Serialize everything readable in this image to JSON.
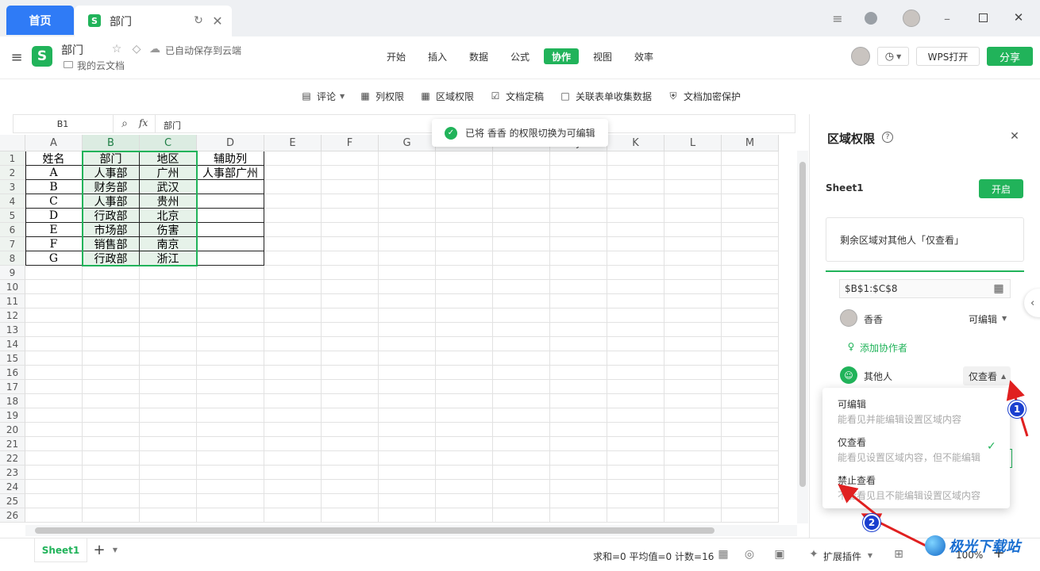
{
  "tabs": {
    "home": "首页",
    "doc": "部门"
  },
  "app": {
    "doc_title": "部门",
    "autosave": "已自动保存到云端",
    "location": "我的云文档"
  },
  "menu": [
    "开始",
    "插入",
    "数据",
    "公式",
    "协作",
    "视图",
    "效率"
  ],
  "actions": {
    "wps_open": "WPS打开",
    "share": "分享"
  },
  "toolbar": [
    "评论",
    "列权限",
    "区域权限",
    "文档定稿",
    "关联表单收集数据",
    "文档加密保护"
  ],
  "formula": {
    "cell_ref": "B1",
    "fx": "fx",
    "value": "部门"
  },
  "toast": "已将 香香 的权限切换为可编辑",
  "grid": {
    "columns": [
      "A",
      "B",
      "C",
      "D",
      "E",
      "F",
      "G",
      "H",
      "I",
      "J",
      "K",
      "L",
      "M"
    ],
    "rows": [
      "1",
      "2",
      "3",
      "4",
      "5",
      "6",
      "7",
      "8",
      "9",
      "10",
      "11",
      "12",
      "13",
      "14",
      "15",
      "16",
      "17",
      "18",
      "19",
      "20",
      "21",
      "22",
      "23",
      "24",
      "25",
      "26"
    ],
    "data": [
      [
        "姓名",
        "部门",
        "地区",
        "辅助列"
      ],
      [
        "A",
        "人事部",
        "广州",
        "人事部广州"
      ],
      [
        "B",
        "财务部",
        "武汉",
        ""
      ],
      [
        "C",
        "人事部",
        "贵州",
        ""
      ],
      [
        "D",
        "行政部",
        "北京",
        ""
      ],
      [
        "E",
        "市场部",
        "伤害",
        ""
      ],
      [
        "F",
        "销售部",
        "南京",
        ""
      ],
      [
        "G",
        "行政部",
        "浙江",
        ""
      ]
    ]
  },
  "status": {
    "sheet": "Sheet1",
    "summary": "求和=0 平均值=0 计数=16",
    "plugins": "扩展插件",
    "zoom": "100%"
  },
  "panel": {
    "title": "区域权限",
    "sheet": "Sheet1",
    "enable": "开启",
    "note": "剩余区域对其他人「仅查看」",
    "range": "$B$1:$C$8",
    "user": "香香",
    "user_perm": "可编辑",
    "add_collab": "添加协作者",
    "others": "其他人",
    "others_perm": "仅查看"
  },
  "dropdown": [
    {
      "title": "可编辑",
      "desc": "能看见并能编辑设置区域内容"
    },
    {
      "title": "仅查看",
      "desc": "能看见设置区域内容，但不能编辑"
    },
    {
      "title": "禁止查看",
      "desc": "不能看见且不能编辑设置区域内容"
    }
  ],
  "callouts": [
    "1",
    "2"
  ],
  "watermark": "极光下载站",
  "colors": {
    "brand_green": "#21b35a",
    "home_blue": "#2f7bf6",
    "selection": "#e3f1e8",
    "callout": "#1a3fcf",
    "arrow": "#e02020"
  }
}
